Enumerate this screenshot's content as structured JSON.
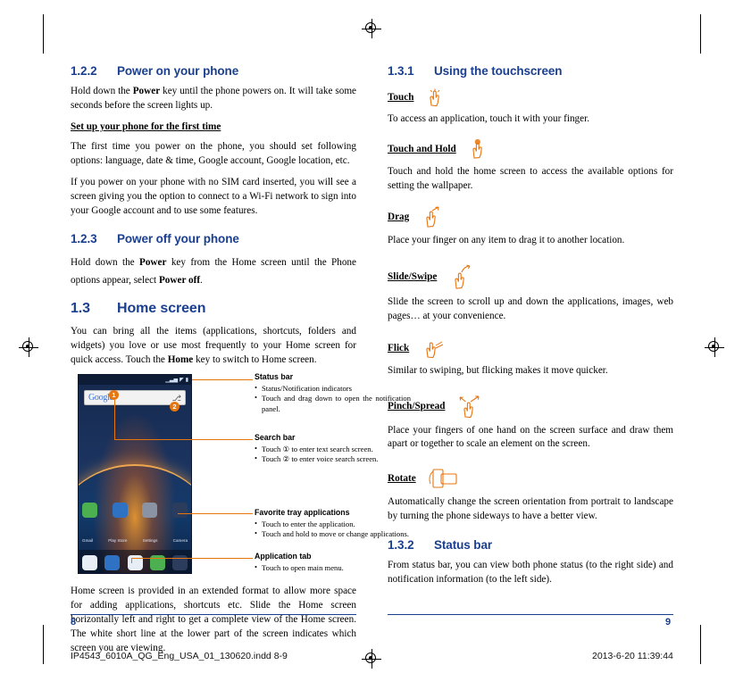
{
  "left_column": {
    "s122": {
      "number": "1.2.2",
      "title": "Power on your phone",
      "body": "Hold down the Power key until the phone powers on. It will take some seconds before the screen lights up.",
      "body_pre": "Hold down the ",
      "body_bold": "Power",
      "body_post": " key until the phone powers on. It will take some seconds before the screen lights up.",
      "subhead": "Set up your phone for the first time",
      "p1": "The first time you power on the phone, you should set following options: language, date & time, Google account, Google location, etc.",
      "p2": "If you power on your phone with no SIM card inserted, you will see a screen giving you the option to connect to a Wi-Fi network to sign into your Google account and to use some features."
    },
    "s123": {
      "number": "1.2.3",
      "title": "Power off your phone",
      "pre": "Hold down the ",
      "bold1": "Power",
      "mid": " key from the Home screen until the Phone options appear, select ",
      "bold2": "Power off",
      "post": "."
    },
    "s13": {
      "number": "1.3",
      "title": "Home screen",
      "pre": "You can bring all the items (applications, shortcuts, folders and widgets) you love or use most frequently to your Home screen for quick access. Touch the ",
      "bold": "Home",
      "post": " key to switch to Home screen."
    },
    "figure": {
      "phone": {
        "status_icons": "▮▮ ⬤ ▮",
        "search_google": "Google",
        "search_mic": "🎤",
        "callout_1": "1",
        "callout_2": "2",
        "app_labels": [
          "Gmail",
          "Play Store",
          "Settings",
          "Camera"
        ]
      },
      "annotations": [
        {
          "title": "Status bar",
          "items": [
            "Status/Notification indicators",
            "Touch and drag down to open the notification panel."
          ]
        },
        {
          "title": "Search bar",
          "items": [
            "Touch ① to enter text search screen.",
            "Touch ② to enter voice search screen."
          ]
        },
        {
          "title": "Favorite tray applications",
          "items": [
            "Touch to enter the application.",
            "Touch and hold to move or change applications."
          ]
        },
        {
          "title": "Application tab",
          "items": [
            "Touch to open main menu."
          ]
        }
      ]
    },
    "closing": "Home screen is provided in an extended format to allow more space for adding applications, shortcuts etc. Slide the Home screen horizontally left and right to get a complete view of the Home screen. The white short line at the lower part of the screen indicates which screen you are viewing."
  },
  "right_column": {
    "s131": {
      "number": "1.3.1",
      "title": "Using the touchscreen",
      "gestures": [
        {
          "name": "Touch",
          "icon": "touch-gesture-icon",
          "text": "To access an application, touch it with your finger."
        },
        {
          "name": "Touch and Hold",
          "icon": "touch-and-hold-gesture-icon",
          "text": "Touch and hold the home screen to access the available options for setting the wallpaper."
        },
        {
          "name": "Drag",
          "icon": "drag-gesture-icon",
          "text": "Place your finger on any item to drag it to another location."
        },
        {
          "name": "Slide/Swipe",
          "icon": "slide-swipe-gesture-icon",
          "text": "Slide the screen to scroll up and down the applications, images, web pages… at your convenience."
        },
        {
          "name": "Flick",
          "icon": "flick-gesture-icon",
          "text": "Similar to swiping, but flicking makes it move quicker."
        },
        {
          "name": "Pinch/Spread",
          "icon": "pinch-spread-gesture-icon",
          "text": "Place your fingers of one hand on the screen surface and draw them apart or together to scale an element on the screen."
        },
        {
          "name": "Rotate",
          "icon": "rotate-gesture-icon",
          "text": "Automatically change the screen orientation from portrait to landscape by turning the phone sideways to have a better view."
        }
      ]
    },
    "s132": {
      "number": "1.3.2",
      "title": "Status bar",
      "body": "From status bar, you can view both phone status (to the right side) and notification information (to the left side)."
    }
  },
  "footer": {
    "page_left": "8",
    "page_right": "9",
    "file_name": "IP4543_6010A_QG_Eng_USA_01_130620.indd   8-9",
    "timestamp": "2013-6-20   11:39:44"
  },
  "colors": {
    "heading_blue": "#1b3f8f",
    "accent_orange": "#e8760f"
  }
}
